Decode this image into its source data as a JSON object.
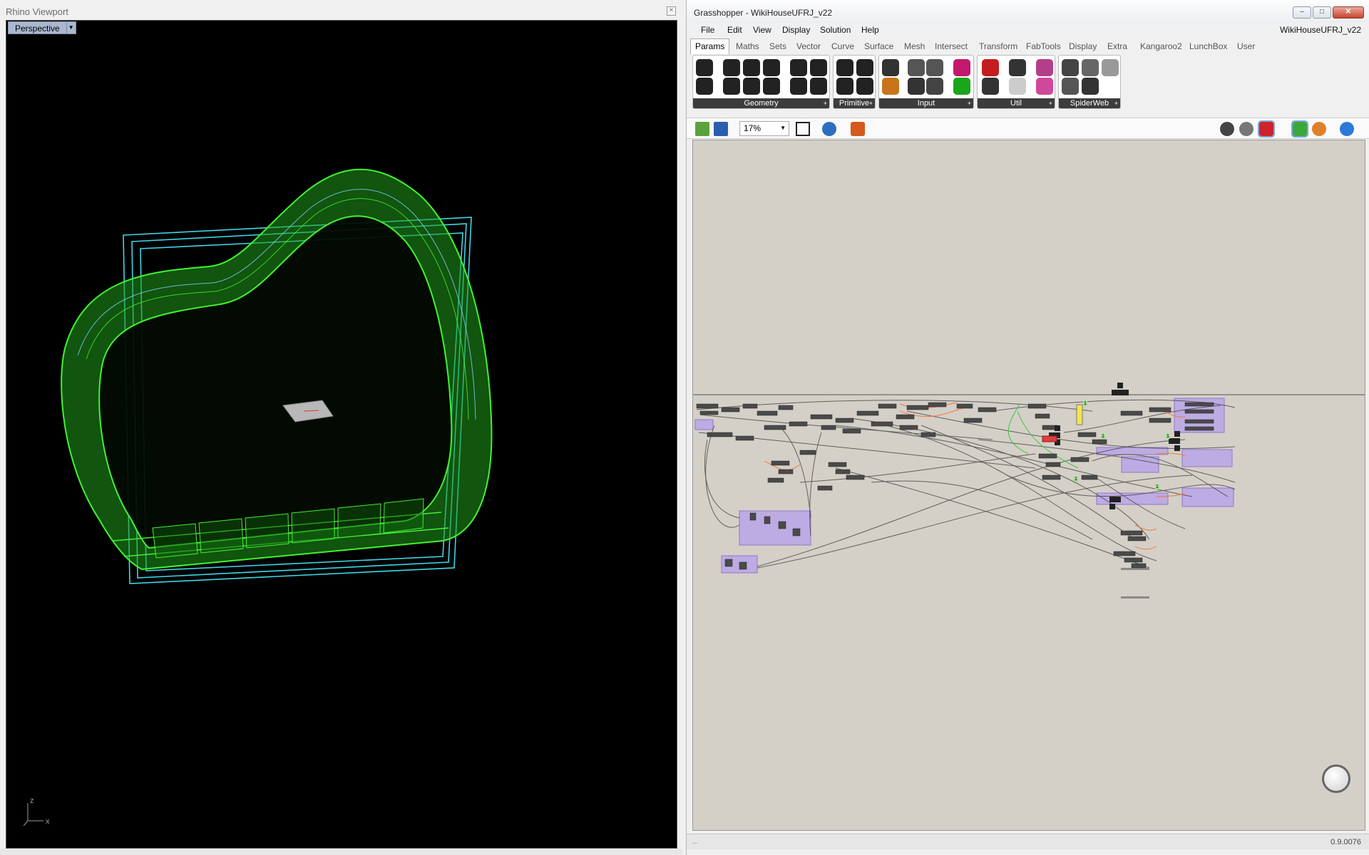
{
  "rhino": {
    "title": "Rhino Viewport",
    "close_glyph": "×",
    "viewport_label": "Perspective",
    "viewport_dropdown_glyph": "▼",
    "axes": {
      "z": "z",
      "x": "x"
    }
  },
  "grasshopper": {
    "title": "Grasshopper - WikiHouseUFRJ_v22",
    "window_buttons": [
      "–",
      "□",
      "✕"
    ],
    "menu": [
      "File",
      "Edit",
      "View",
      "Display",
      "Solution",
      "Help"
    ],
    "document_name": "WikiHouseUFRJ_v22",
    "tabs": [
      "Params",
      "Maths",
      "Sets",
      "Vector",
      "Curve",
      "Surface",
      "Mesh",
      "Intersect",
      "Transform",
      "FabTools",
      "Display",
      "Extra",
      "Kangaroo2",
      "LunchBox",
      "User"
    ],
    "active_tab": "Params",
    "ribbon_groups": [
      "Geometry",
      "Primitive",
      "Input",
      "Util",
      "SpiderWeb"
    ],
    "ribbon_group_expander": "+",
    "zoom": "17%",
    "zoom_dropdown_glyph": "▼",
    "canvas_labels": [
      "1",
      "1",
      "1",
      "1",
      "1"
    ],
    "status_left": "...",
    "version": "0.9.0076"
  },
  "colors": {
    "viewport_bg": "#000000",
    "model_green": "#35d62a",
    "model_outline": "#2ce61f",
    "frame_cyan": "#3fd6e6",
    "canvas_bg": "#d4d0c8",
    "group_purple": "#b9a4e8",
    "wire": "#3a3a3a",
    "wire_orange": "#f07a3a"
  }
}
